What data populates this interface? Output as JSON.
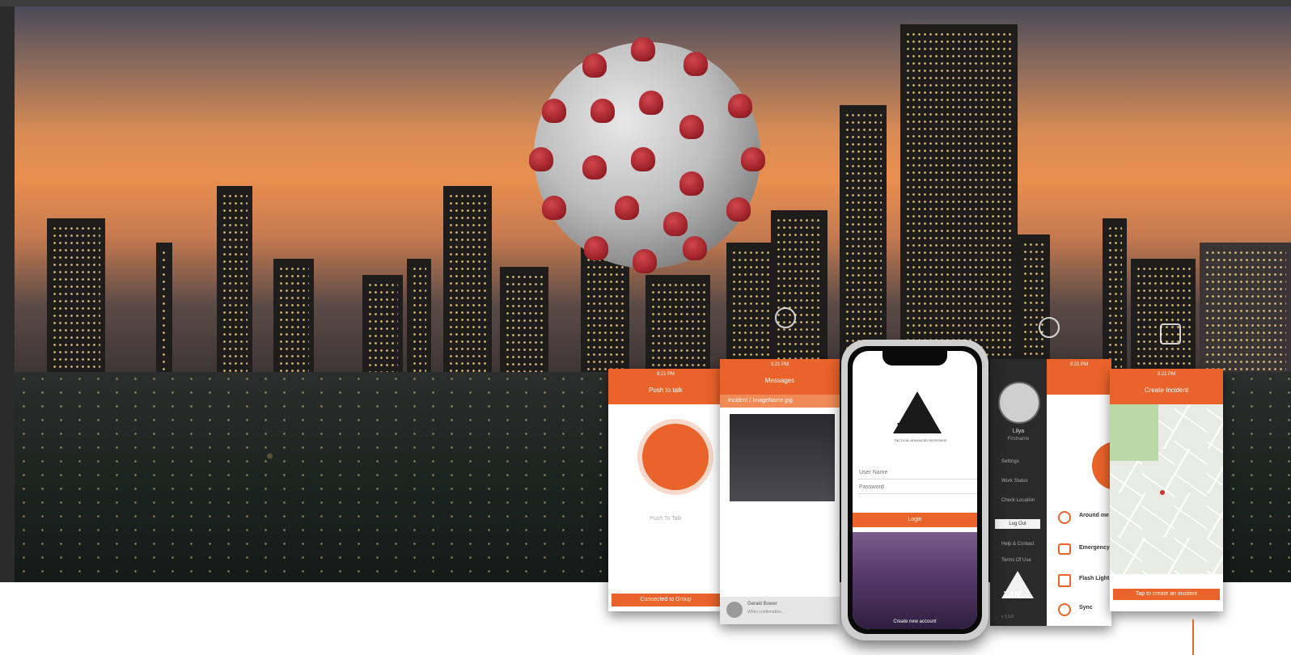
{
  "hero": {
    "description_colors": {
      "sky_top": "#4a4a58",
      "sky_glow": "#e98f4f",
      "accent": "#e9632a"
    }
  },
  "screens": {
    "push_to_talk": {
      "header_title": "Push to talk",
      "status": "9:21 PM",
      "label": "Push To Talk",
      "footer_button": "Connected to Group"
    },
    "messages": {
      "header_title": "Messages",
      "status": "9:21 PM",
      "attachment": "Incident / ImageName.jpg",
      "sender_name": "Gerald Bower",
      "sender_sub": "When confirmation..."
    },
    "login": {
      "username_placeholder": "User Name",
      "password_placeholder": "Password",
      "login_button": "Login",
      "logo": "TAR",
      "logo_sub": "TACTICAL ADVANCED RESPONSE",
      "footer_text": "Create new account"
    },
    "profile": {
      "name": "Lilya",
      "role": "Firstname",
      "menu": [
        "Settings",
        "Work Status",
        "Check Location",
        "Log Out",
        "Help & Contact",
        "Terms Of Use"
      ],
      "logo": "TAR",
      "version": "v 1.0.0"
    },
    "features": {
      "status": "9:21 PM",
      "items": [
        "Around me",
        "Emergency",
        "Flash Light",
        "Sync"
      ]
    },
    "create_incident": {
      "header_title": "Create Incident",
      "status": "9:21 PM",
      "button": "Tap to create an incident"
    }
  }
}
